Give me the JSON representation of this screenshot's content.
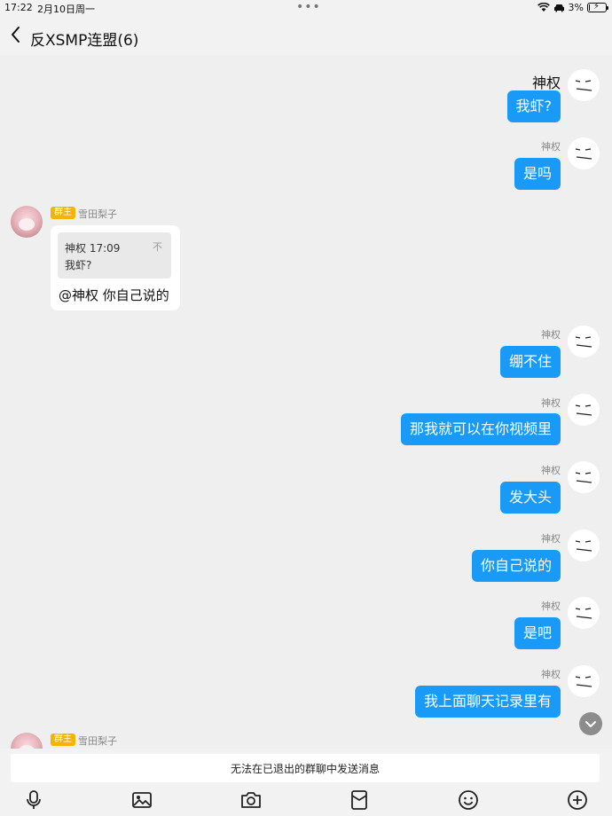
{
  "status_bar": {
    "time": "17:22",
    "date": "2月10日周一",
    "dots": "•••",
    "battery": "3%"
  },
  "nav": {
    "title": "反XSMP连盟(6)"
  },
  "messages": [
    {
      "sender": "神权",
      "text": "我虾?"
    },
    {
      "sender": "神权",
      "text": "是吗"
    },
    {
      "sender": "神权",
      "text": "绷不住"
    },
    {
      "sender": "神权",
      "text": "那我就可以在你视频里"
    },
    {
      "sender": "神权",
      "text": "发大头"
    },
    {
      "sender": "神权",
      "text": "你自己说的"
    },
    {
      "sender": "神权",
      "text": "是吧"
    },
    {
      "sender": "神权",
      "text": "我上面聊天记录里有"
    }
  ],
  "incoming": [
    {
      "role": "群主",
      "sender": "雪田梨子",
      "quote_head": "神权 17:09",
      "quote_text": "我虾?",
      "quote_mark": "不",
      "text": "@神权 你自己说的"
    },
    {
      "role": "群主",
      "sender": "雪田梨子"
    }
  ],
  "notice": "无法在已退出的群聊中发送消息",
  "toolbar": [
    "mic-icon",
    "image-icon",
    "camera-icon",
    "red-packet-icon",
    "emoji-icon",
    "plus-icon"
  ],
  "colors": {
    "bubble_out": "#1a9af7",
    "badge": "#f4b400",
    "background": "#efefef"
  }
}
